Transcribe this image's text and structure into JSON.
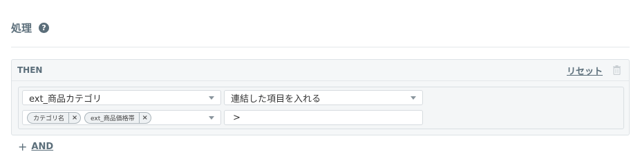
{
  "section": {
    "title": "処理",
    "help": "?"
  },
  "then_block": {
    "label": "THEN",
    "reset_label": "リセット",
    "row": {
      "field_select": {
        "value": "ext_商品カテゴリ"
      },
      "action_select": {
        "value": "連結した項目を入れる"
      },
      "source_fields": [
        {
          "label": "カテゴリ名",
          "remove": "×"
        },
        {
          "label": "ext_商品価格帯",
          "remove": "×"
        }
      ],
      "separator_input": {
        "value": ">"
      }
    }
  },
  "add_condition": {
    "plus": "+",
    "label": "AND"
  },
  "colors": {
    "accent": "#5b6e7a",
    "card_bg": "#f5f7f8",
    "border": "#dde2e6"
  }
}
